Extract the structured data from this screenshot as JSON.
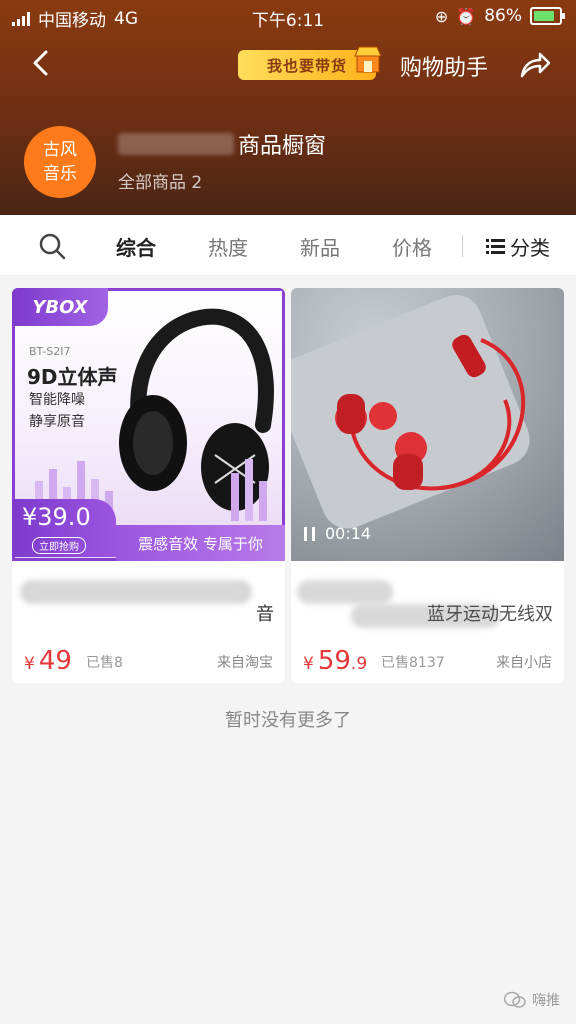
{
  "status_bar": {
    "carrier": "中国移动",
    "network": "4G",
    "time": "下午6:11",
    "battery_percent": "86%"
  },
  "nav": {
    "promo_label": "我也要带货",
    "assistant_label": "购物助手"
  },
  "shop": {
    "avatar_line1": "古风",
    "avatar_line2": "音乐",
    "name_suffix": "商品橱窗",
    "subtitle": "全部商品 2"
  },
  "tabs": {
    "items": [
      {
        "label": "综合"
      },
      {
        "label": "热度"
      },
      {
        "label": "新品"
      },
      {
        "label": "价格"
      }
    ],
    "category_label": "分类"
  },
  "products": [
    {
      "title": "音\n乐游戏运动型跑步耳麦电脑",
      "price_int": "49",
      "price_dec": "",
      "currency": "¥",
      "sold": "已售8",
      "source": "来自淘宝",
      "image": {
        "brand": "YBOX",
        "model": "BT-S2I7",
        "headline": "9D立体声",
        "feature1": "智能降噪",
        "feature2": "静享原音",
        "price_tag": "¥39.0",
        "buy_now": "立即抢购",
        "slogan": "震感音效 专属于你"
      }
    },
    {
      "title": "蓝牙运动无线双\n耳入耳挂脖式耳机【所有手",
      "price_int": "59",
      "price_dec": ".9",
      "currency": "¥",
      "sold": "已售8137",
      "source": "来自小店",
      "video_duration": "00:14"
    }
  ],
  "footer_text": "暂时没有更多了",
  "watermark": "嗨推",
  "colors": {
    "header_top": "#8a3a10",
    "avatar": "#ff7a1a",
    "price": "#e4393c",
    "battery_fill": "#6be06b"
  }
}
